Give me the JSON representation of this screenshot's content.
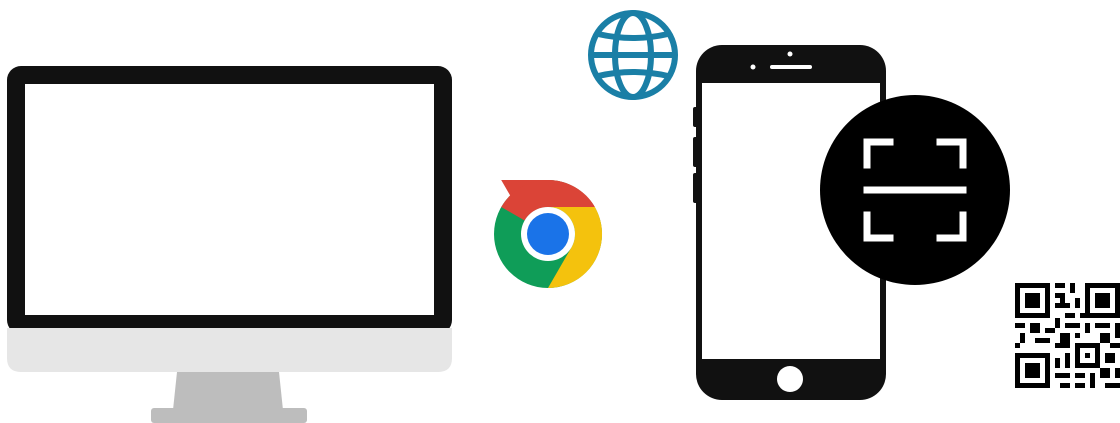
{
  "illustration": {
    "icons": [
      "desktop-monitor-icon",
      "chrome-logo-icon",
      "globe-icon",
      "smartphone-icon",
      "qr-scan-icon",
      "qr-code-icon"
    ]
  },
  "colors": {
    "monitor_bezel": "#111111",
    "monitor_screen": "#ffffff",
    "monitor_chin": "#e6e6e6",
    "monitor_stand": "#bdbdbd",
    "chrome_red": "#db4437",
    "chrome_yellow": "#f4c20d",
    "chrome_green": "#0f9d58",
    "chrome_blue": "#4285f4",
    "globe": "#1a7fa6",
    "phone_body": "#111111",
    "scan_circle": "#000000",
    "qr": "#000000"
  }
}
